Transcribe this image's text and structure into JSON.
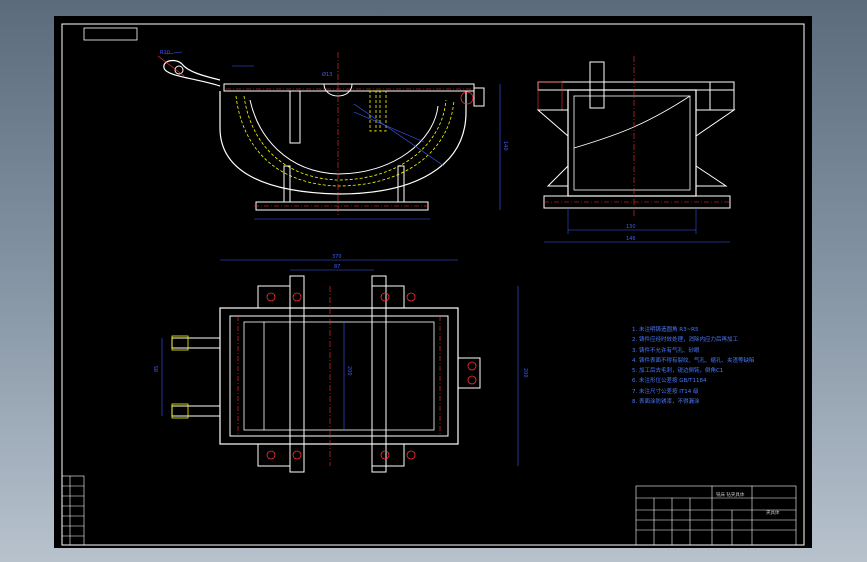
{
  "drawing": {
    "technical_notes": [
      "1. 未注明铸造圆角 R3~R5",
      "2. 铸件应经时效处理，消除内应力后再加工",
      "3. 铸件不允许有气孔、砂眼",
      "4. 铸件表面不得有裂纹、气孔、缩孔、夹渣等缺陷",
      "5. 加工后去毛刺，锐边倒钝，倒角C1",
      "6. 未注形位公差按 GB/T1184",
      "7. 未注尺寸公差按 IT14 级",
      "8. 表面涂防锈漆，不得漏涂"
    ],
    "dimensions": {
      "top_view_length": "370",
      "top_view_inner": "87",
      "top_view_height": "200",
      "top_view_side": "200",
      "side_view_bottom": "130",
      "side_view_overall": "146",
      "front_height": "140",
      "left_offset": "85",
      "radius_label": "R10",
      "note_label": "Ø13"
    },
    "title_block": {
      "drawing_name": "铣床 钻夹具体",
      "sheet_label": "夹具体"
    },
    "colors": {
      "outline": "#ffffff",
      "geometry": "#ffffff",
      "dimension": "#3d5cff",
      "center": "#ff3030",
      "hidden": "#ffff00"
    }
  }
}
